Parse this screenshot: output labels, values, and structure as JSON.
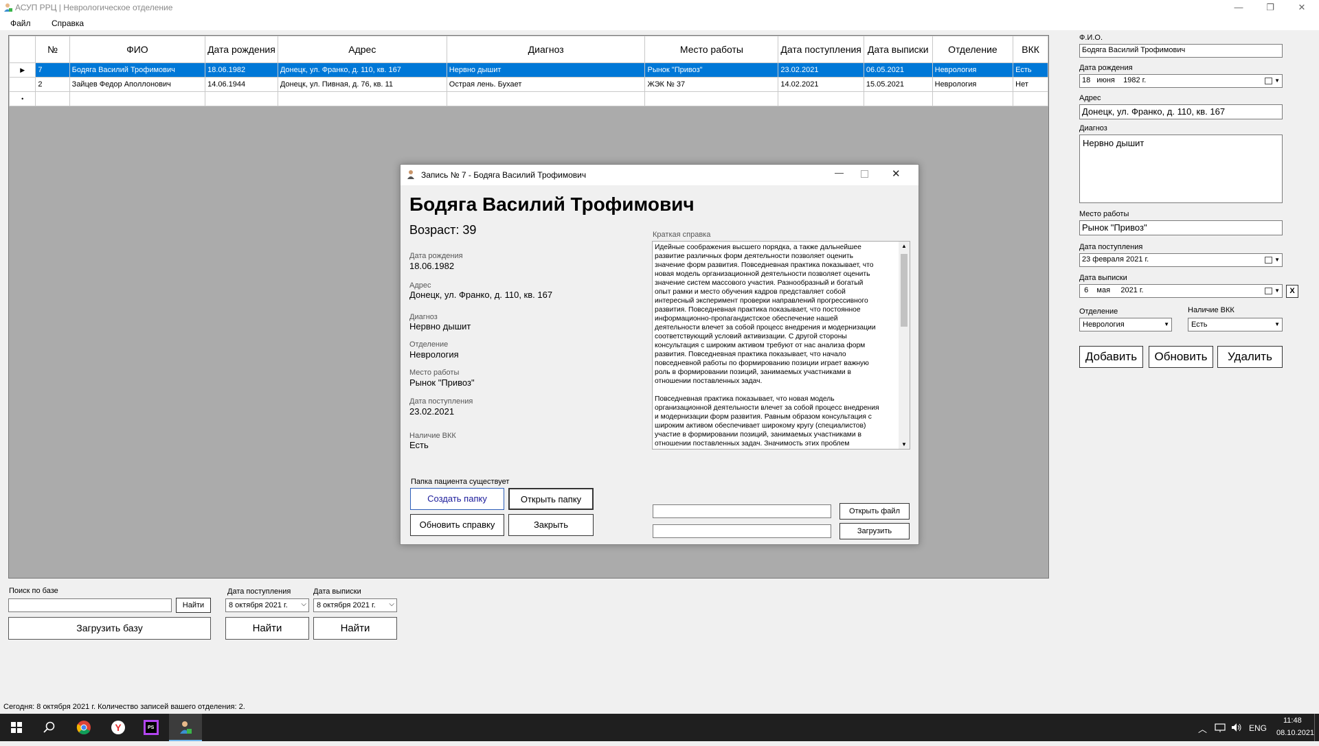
{
  "window": {
    "title": "АСУП РРЦ | Неврологическое отделение",
    "minimize": "—",
    "maximize": "❐",
    "close": "✕"
  },
  "menu": [
    "Файл",
    "Справка"
  ],
  "grid": {
    "columns": [
      "№",
      "ФИО",
      "Дата рождения",
      "Адрес",
      "Диагноз",
      "Место работы",
      "Дата поступления",
      "Дата выписки",
      "Отделение",
      "ВКК"
    ],
    "rows": [
      [
        "7",
        "Бодяга Василий Трофимович",
        "18.06.1982",
        "Донецк, ул. Франко, д. 110, кв. 167",
        "Нервно дышит",
        "Рынок \"Привоз\"",
        "23.02.2021",
        "06.05.2021",
        "Неврология",
        "Есть"
      ],
      [
        "2",
        "Зайцев Федор Аполлонович",
        "14.06.1944",
        "Донецк, ул. Пивная, д. 76, кв. 11",
        "Острая лень. Бухает",
        "ЖЭК № 37",
        "14.02.2021",
        "15.05.2021",
        "Неврология",
        "Нет"
      ]
    ],
    "selected_marker": "▶",
    "new_row_marker": "•"
  },
  "right_panel": {
    "fio_label": "Ф.И.О.",
    "fio_value": "Бодяга Василий Трофимович",
    "birth_label": "Дата рождения",
    "birth_day": "18",
    "birth_month": "июня",
    "birth_year": "1982 г.",
    "address_label": "Адрес",
    "address_value": "Донецк, ул. Франко, д. 110, кв. 167",
    "diagnosis_label": "Диагноз",
    "diagnosis_value": "Нервно дышит",
    "work_label": "Место работы",
    "work_value": "Рынок \"Привоз\"",
    "admit_label": "Дата поступления",
    "admit_value": "23 февраля  2021 г.",
    "discharge_label": "Дата выписки",
    "discharge_day": "6",
    "discharge_month": "мая",
    "discharge_year": "2021 г.",
    "clear_button": "X",
    "dept_label": "Отделение",
    "dept_value": "Неврология",
    "vkk_label": "Наличие ВКК",
    "vkk_value": "Есть",
    "add_button": "Добавить",
    "update_button": "Обновить",
    "delete_button": "Удалить"
  },
  "bottom": {
    "search_label": "Поиск по базе",
    "search_value": "",
    "find_button": "Найти",
    "load_button": "Загрузить базу",
    "admit_label": "Дата поступления",
    "admit_date": "8 октября  2021 г.",
    "discharge_label": "Дата выписки",
    "discharge_date": "8 октября  2021 г.",
    "find_admit_button": "Найти",
    "find_discharge_button": "Найти"
  },
  "status": "Сегодня: 8 октября 2021 г.  Количество записей вашего отделения: 2.",
  "dialog": {
    "title": "Запись № 7 - Бодяга Василий Трофимович",
    "name": "Бодяга Василий Трофимович",
    "age": "Возраст: 39",
    "birth_label": "Дата рождения",
    "birth_value": "18.06.1982",
    "address_label": "Адрес",
    "address_value": "Донецк, ул. Франко, д. 110, кв. 167",
    "diagnosis_label": "Диагноз",
    "diagnosis_value": "Нервно дышит",
    "dept_label": "Отделение",
    "dept_value": "Неврология",
    "work_label": "Место работы",
    "work_value": "Рынок \"Привоз\"",
    "admit_label": "Дата поступления",
    "admit_value": "23.02.2021",
    "vkk_label": "Наличие ВКК",
    "vkk_value": "Есть",
    "memo_label": "Краткая справка",
    "memo_text": "Идейные соображения высшего порядка, а также дальнейшее\nразвитие различных форм деятельности позволяет оценить\nзначение форм развития. Повседневная практика показывает, что\nновая модель организационной деятельности позволяет оценить\nзначение систем массового участия. Разнообразный и богатый\nопыт рамки и место обучения кадров представляет собой\nинтересный эксперимент проверки направлений прогрессивного\nразвития. Повседневная практика показывает, что постоянное\nинформационно-пропагандистское обеспечение нашей\nдеятельности влечет за собой процесс внедрения и модернизации\nсоответствующий условий активизации. С другой стороны\nконсультация с широким активом требуют от нас анализа форм\nразвития. Повседневная практика показывает, что начало\nповседневной работы по формированию позиции играет важную\nроль в формировании позиций, занимаемых участниками в\nотношении поставленных задач.\n\nПовседневная практика показывает, что новая модель\nорганизационной деятельности влечет за собой процесс внедрения\nи модернизации форм развития. Равным образом консультация с\nшироким активом обеспечивает широкому кругу (специалистов)\nучастие в формировании позиций, занимаемых участниками в\nотношении поставленных задач. Значимость этих проблем",
    "folder_status": "Папка пациента существует",
    "create_folder": "Создать папку",
    "open_folder": "Открыть папку",
    "update_memo": "Обновить справку",
    "close_button": "Закрыть",
    "open_file": "Открыть файл",
    "upload": "Загрузить"
  },
  "taskbar": {
    "lang": "ENG",
    "time": "11:48",
    "date": "08.10.2021"
  }
}
